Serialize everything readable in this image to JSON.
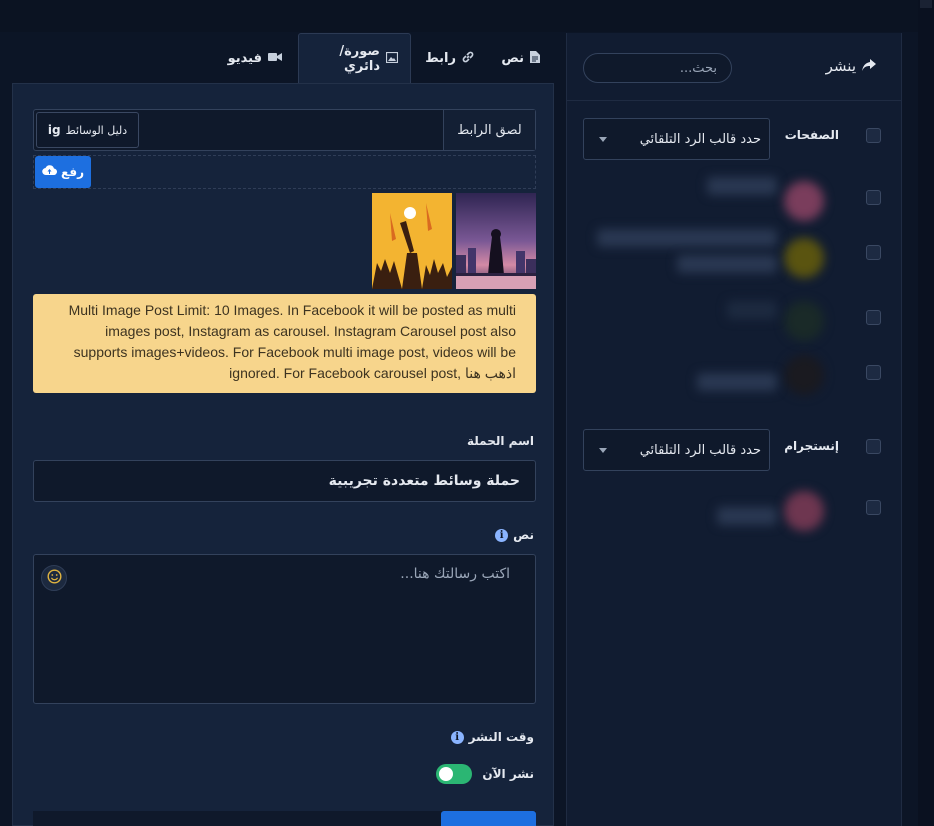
{
  "publish_panel": {
    "title": "ينشر",
    "search_placeholder": "بحث...",
    "groups": [
      {
        "label": "الصفحات",
        "select_value": "حدد قالب الرد التلقائي"
      },
      {
        "label": "إنستجرام",
        "select_value": "حدد قالب الرد التلقائي"
      }
    ]
  },
  "tabs": [
    {
      "label": "نص",
      "icon": "file-icon"
    },
    {
      "label": "رابط",
      "icon": "link-icon"
    },
    {
      "label": "صورة/دائري",
      "icon": "image-icon",
      "active": true
    },
    {
      "label": "فيديو",
      "icon": "video-icon"
    }
  ],
  "media": {
    "url_addon": "لصق الرابط",
    "media_guide_label": "دليل الوسائط",
    "media_guide_badge": "ig",
    "upload_label": "رفع"
  },
  "alert_text": "Multi Image Post Limit: 10 Images. In Facebook it will be posted as multi images post, Instagram as carousel. Instagram Carousel post also supports images+videos. For Facebook multi image post, videos will be ignored. For Facebook carousel post, اذهب هنا",
  "campaign": {
    "label": "اسم الحملة",
    "value": "حملة وسائط متعددة تجريبية"
  },
  "message": {
    "label": "نص",
    "placeholder": "اكتب رسالتك هنا..."
  },
  "schedule": {
    "label": "وقت النشر",
    "toggle_label": "نشر الآن",
    "toggle_on": true
  },
  "colors": {
    "accent": "#1d6fe0",
    "alert_bg": "#f7d58c",
    "toggle_on": "#2bb673"
  }
}
